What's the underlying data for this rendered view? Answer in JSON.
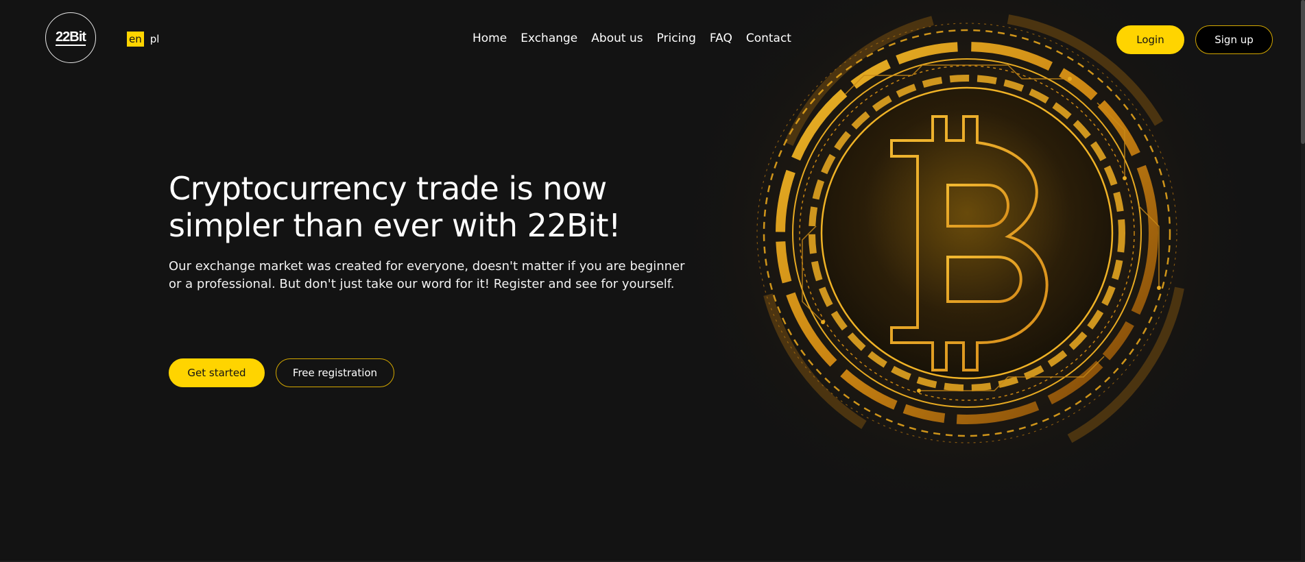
{
  "header": {
    "logo": "22Bit",
    "languages": [
      {
        "code": "en",
        "active": true
      },
      {
        "code": "pl",
        "active": false
      }
    ],
    "nav": [
      "Home",
      "Exchange",
      "About us",
      "Pricing",
      "FAQ",
      "Contact"
    ],
    "login_label": "Login",
    "signup_label": "Sign up"
  },
  "hero": {
    "headline": "Cryptocurrency trade is now simpler than ever with 22Bit!",
    "subtext": "Our exchange market was created for everyone, doesn't matter if you are beginner or a professional. But don't just take our word for it! Register and see for yourself.",
    "primary_button": "Get started",
    "secondary_button": "Free registration",
    "illustration": "bitcoin-icon"
  },
  "colors": {
    "background": "#131313",
    "accent": "#ffd400",
    "gold": "#d99a14"
  }
}
